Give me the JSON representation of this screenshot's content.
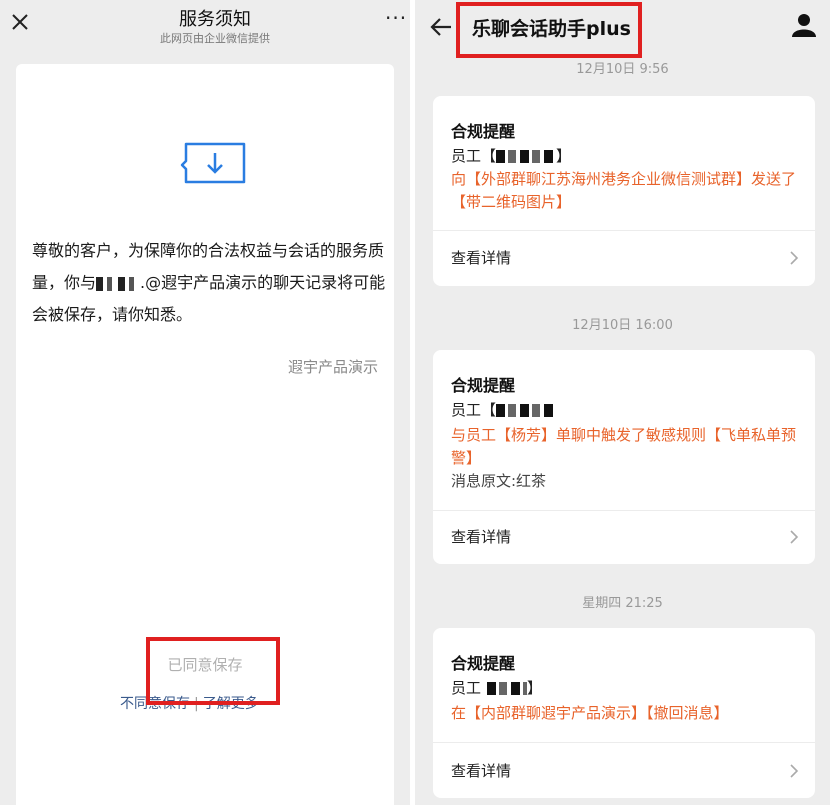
{
  "left": {
    "header": {
      "title": "服务须知",
      "subtitle": "此网页由企业微信提供"
    },
    "notice": {
      "before": "尊敬的客户，为保障你的合法权益与会话的服务质量，你与",
      "after": ".@遐宇产品演示的聊天记录将可能会被保存，请你知悉。",
      "sign": "遐宇产品演示"
    },
    "agreed_label": "已同意保存",
    "disagree_label": "不同意保存",
    "separator": "|",
    "learn_more_label": "了解更多"
  },
  "right": {
    "header": {
      "title": "乐聊会话助手plus"
    },
    "messages": [
      {
        "timestamp": "12月10日  9:56",
        "title": "合规提醒",
        "employee_prefix": "员工【",
        "employee_suffix": "】",
        "orange_text": "向【外部群聊江苏海州港务企业微信测试群】发送了【带二维码图片】",
        "extra_text": "",
        "detail_label": "查看详情"
      },
      {
        "timestamp": "12月10日  16:00",
        "title": "合规提醒",
        "employee_prefix": "员工【",
        "employee_suffix": "",
        "orange_text": "与员工【杨芳】单聊中触发了敏感规则【飞单私单预警】",
        "extra_text": "消息原文:红茶",
        "detail_label": "查看详情"
      },
      {
        "timestamp": "星期四  21:25",
        "title": "合规提醒",
        "employee_prefix": "员工",
        "employee_suffix": "】",
        "orange_text": "在【内部群聊遐宇产品演示】【撤回消息】",
        "extra_text": "",
        "detail_label": "查看详情"
      }
    ]
  },
  "colors": {
    "highlight_box": "#e02020",
    "orange": "#e8632b",
    "link_blue": "#3a5a8c"
  }
}
